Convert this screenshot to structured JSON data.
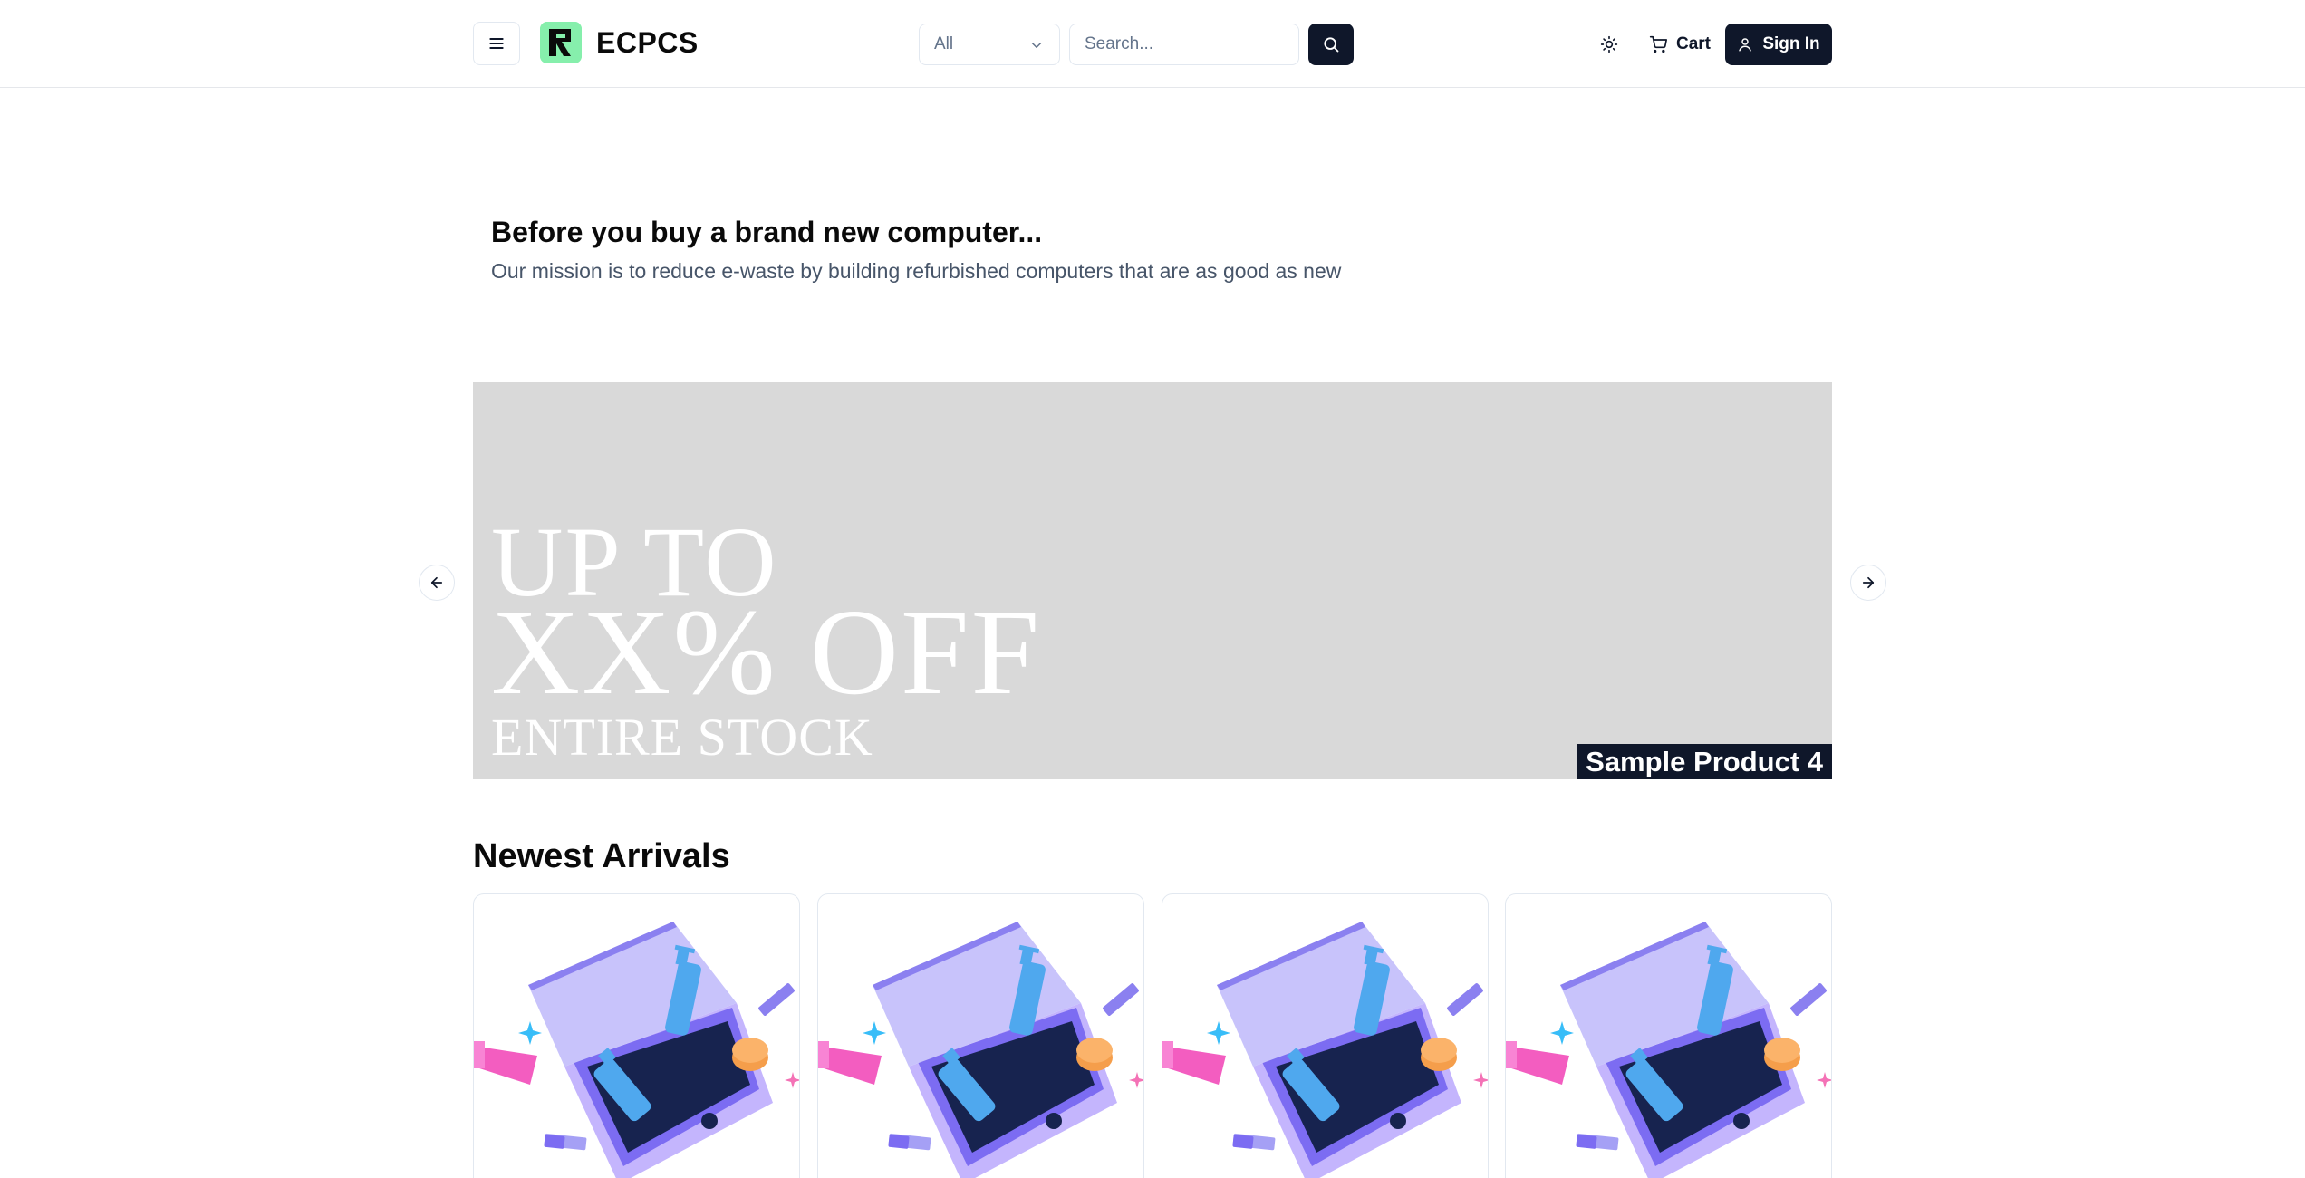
{
  "header": {
    "brand": "ECPCS",
    "category_select": {
      "value": "All"
    },
    "search": {
      "placeholder": "Search..."
    },
    "cart_label": "Cart",
    "signin_label": "Sign In"
  },
  "hero": {
    "title": "Before you buy a brand new computer...",
    "subtitle": "Our mission is to reduce e-waste by building refurbished computers that are as good as new"
  },
  "carousel": {
    "promo_line1": "UP TO",
    "promo_line2": "XX% OFF",
    "promo_line3": "ENTIRE STOCK",
    "caption": "Sample Product 4"
  },
  "newest": {
    "title": "Newest Arrivals",
    "items": [
      {
        "image": "product-box-illustration"
      },
      {
        "image": "product-box-illustration"
      },
      {
        "image": "product-box-illustration"
      },
      {
        "image": "product-box-illustration"
      }
    ]
  },
  "colors": {
    "primary": "#0f172a",
    "logo_bg": "#86efac",
    "banner_bg": "#d9d9d9",
    "muted_text": "#475569"
  },
  "icons": [
    "menu-icon",
    "logo-icon",
    "chevron-down-icon",
    "search-icon",
    "sun-icon",
    "cart-icon",
    "user-icon",
    "arrow-left-icon",
    "arrow-right-icon"
  ]
}
